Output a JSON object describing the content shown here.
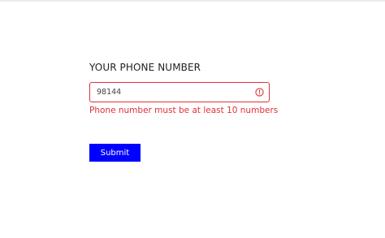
{
  "form": {
    "label": "YOUR PHONE NUMBER",
    "phone_value": "98144",
    "error_message": "Phone number must be at least 10 numbers",
    "submit_label": "Submit",
    "error_icon": "error-circle-icon"
  },
  "colors": {
    "error": "#e0303a",
    "submit_bg": "#0000ff",
    "submit_text": "#ffffff",
    "label_text": "#222222"
  }
}
